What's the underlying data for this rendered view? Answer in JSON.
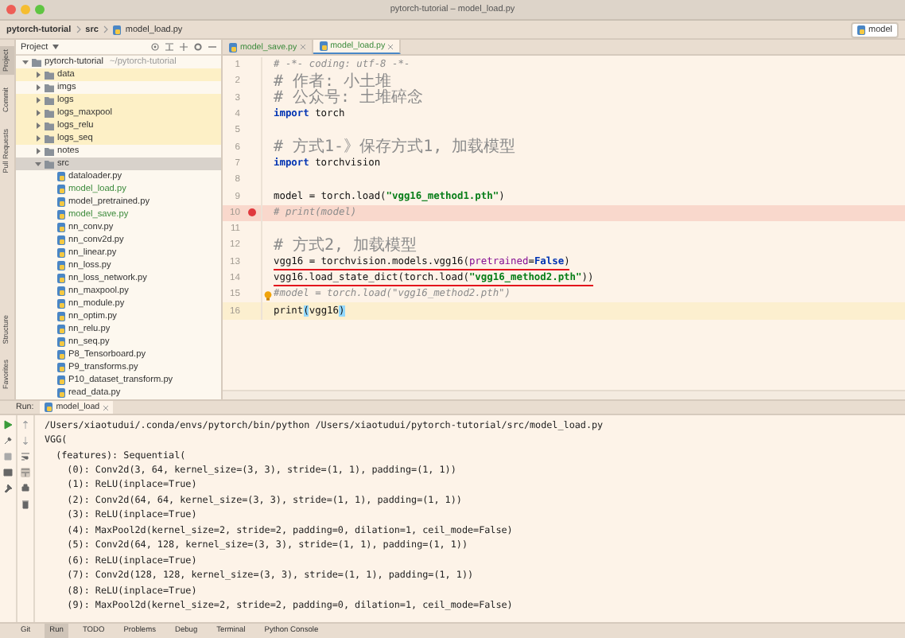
{
  "window": {
    "title": "pytorch-tutorial – model_load.py"
  },
  "breadcrumb": [
    "pytorch-tutorial",
    "src",
    "model_load.py"
  ],
  "run_config": {
    "label": "model"
  },
  "left_strip": {
    "top": [
      {
        "label": "Project",
        "selected": true
      },
      {
        "label": "Commit",
        "selected": false
      },
      {
        "label": "Pull Requests",
        "selected": false
      }
    ],
    "bottom": [
      {
        "label": "Structure",
        "selected": false
      },
      {
        "label": "Favorites",
        "selected": false
      }
    ]
  },
  "project_panel": {
    "title": "Project",
    "tree": [
      {
        "label": "pytorch-tutorial",
        "path": "~/pytorch-tutorial",
        "kind": "folder",
        "expanded": true,
        "selected": false,
        "excluded": false,
        "added": false,
        "children": [
          {
            "label": "data",
            "kind": "folder",
            "expanded": false,
            "selected": false,
            "excluded": true,
            "added": false
          },
          {
            "label": "imgs",
            "kind": "folder",
            "expanded": false,
            "selected": false,
            "excluded": false,
            "added": false
          },
          {
            "label": "logs",
            "kind": "folder",
            "expanded": false,
            "selected": false,
            "excluded": true,
            "added": false
          },
          {
            "label": "logs_maxpool",
            "kind": "folder",
            "expanded": false,
            "selected": false,
            "excluded": true,
            "added": false
          },
          {
            "label": "logs_relu",
            "kind": "folder",
            "expanded": false,
            "selected": false,
            "excluded": true,
            "added": false
          },
          {
            "label": "logs_seq",
            "kind": "folder",
            "expanded": false,
            "selected": false,
            "excluded": true,
            "added": false
          },
          {
            "label": "notes",
            "kind": "folder",
            "expanded": false,
            "selected": false,
            "excluded": false,
            "added": false
          },
          {
            "label": "src",
            "kind": "folder",
            "expanded": true,
            "selected": true,
            "excluded": false,
            "added": false,
            "children": [
              {
                "label": "dataloader.py",
                "kind": "file",
                "selected": false,
                "excluded": false,
                "added": false
              },
              {
                "label": "model_load.py",
                "kind": "file",
                "selected": false,
                "excluded": false,
                "added": true
              },
              {
                "label": "model_pretrained.py",
                "kind": "file",
                "selected": false,
                "excluded": false,
                "added": false
              },
              {
                "label": "model_save.py",
                "kind": "file",
                "selected": false,
                "excluded": false,
                "added": true
              },
              {
                "label": "nn_conv.py",
                "kind": "file",
                "selected": false,
                "excluded": false,
                "added": false
              },
              {
                "label": "nn_conv2d.py",
                "kind": "file",
                "selected": false,
                "excluded": false,
                "added": false
              },
              {
                "label": "nn_linear.py",
                "kind": "file",
                "selected": false,
                "excluded": false,
                "added": false
              },
              {
                "label": "nn_loss.py",
                "kind": "file",
                "selected": false,
                "excluded": false,
                "added": false
              },
              {
                "label": "nn_loss_network.py",
                "kind": "file",
                "selected": false,
                "excluded": false,
                "added": false
              },
              {
                "label": "nn_maxpool.py",
                "kind": "file",
                "selected": false,
                "excluded": false,
                "added": false
              },
              {
                "label": "nn_module.py",
                "kind": "file",
                "selected": false,
                "excluded": false,
                "added": false
              },
              {
                "label": "nn_optim.py",
                "kind": "file",
                "selected": false,
                "excluded": false,
                "added": false
              },
              {
                "label": "nn_relu.py",
                "kind": "file",
                "selected": false,
                "excluded": false,
                "added": false
              },
              {
                "label": "nn_seq.py",
                "kind": "file",
                "selected": false,
                "excluded": false,
                "added": false
              },
              {
                "label": "P8_Tensorboard.py",
                "kind": "file",
                "selected": false,
                "excluded": false,
                "added": false
              },
              {
                "label": "P9_transforms.py",
                "kind": "file",
                "selected": false,
                "excluded": false,
                "added": false
              },
              {
                "label": "P10_dataset_transform.py",
                "kind": "file",
                "selected": false,
                "excluded": false,
                "added": false
              },
              {
                "label": "read_data.py",
                "kind": "file",
                "selected": false,
                "excluded": false,
                "added": false
              }
            ]
          }
        ]
      }
    ]
  },
  "editor": {
    "tabs": [
      {
        "label": "model_save.py",
        "selected": false
      },
      {
        "label": "model_load.py",
        "selected": true
      }
    ],
    "lines": [
      {
        "number": "1",
        "breakpoint": false,
        "current": false,
        "underlined": false,
        "intention": false,
        "segments": [
          {
            "text": "# -*- coding: utf-8 -*-",
            "kind": "comment"
          }
        ]
      },
      {
        "number": "2",
        "breakpoint": false,
        "current": false,
        "underlined": false,
        "intention": false,
        "segments": [
          {
            "text": "# 作者: 小土堆",
            "kind": "comment"
          }
        ]
      },
      {
        "number": "3",
        "breakpoint": false,
        "current": false,
        "underlined": false,
        "intention": false,
        "segments": [
          {
            "text": "# 公众号: 土堆碎念",
            "kind": "comment"
          }
        ]
      },
      {
        "number": "4",
        "breakpoint": false,
        "current": false,
        "underlined": false,
        "intention": false,
        "segments": [
          {
            "text": "import",
            "kind": "keyword"
          },
          {
            "text": " torch",
            "kind": "plain"
          }
        ]
      },
      {
        "number": "5",
        "breakpoint": false,
        "current": false,
        "intention": false
      },
      {
        "number": "6",
        "breakpoint": false,
        "current": false,
        "underlined": false,
        "intention": false,
        "segments": [
          {
            "text": "# 方式1-》保存方式1, 加载模型",
            "kind": "comment"
          }
        ]
      },
      {
        "number": "7",
        "breakpoint": false,
        "current": false,
        "underlined": false,
        "intention": false,
        "segments": [
          {
            "text": "import",
            "kind": "keyword"
          },
          {
            "text": " torchvision",
            "kind": "plain"
          }
        ]
      },
      {
        "number": "8",
        "breakpoint": false,
        "current": false,
        "intention": false
      },
      {
        "number": "9",
        "breakpoint": false,
        "current": false,
        "underlined": false,
        "intention": false,
        "segments": [
          {
            "text": "model = torch.load(",
            "kind": "plain"
          },
          {
            "text": "\"vgg16_method1.pth\"",
            "kind": "string"
          },
          {
            "text": ")",
            "kind": "plain"
          }
        ]
      },
      {
        "number": "10",
        "breakpoint": true,
        "current": false,
        "underlined": false,
        "intention": false,
        "segments": [
          {
            "text": "# print(model)",
            "kind": "comment"
          }
        ]
      },
      {
        "number": "11",
        "breakpoint": false,
        "current": false,
        "intention": false
      },
      {
        "number": "12",
        "breakpoint": false,
        "current": false,
        "underlined": false,
        "intention": false,
        "segments": [
          {
            "text": "# 方式2, 加载模型",
            "kind": "comment"
          }
        ]
      },
      {
        "number": "13",
        "breakpoint": false,
        "current": false,
        "underlined": true,
        "intention": false,
        "segments": [
          {
            "text": "vgg16 = torchvision.models.vgg16(",
            "kind": "plain"
          },
          {
            "text": "pretrained",
            "kind": "param"
          },
          {
            "text": "=",
            "kind": "plain"
          },
          {
            "text": "False",
            "kind": "keyword"
          },
          {
            "text": ")",
            "kind": "plain"
          }
        ]
      },
      {
        "number": "14",
        "breakpoint": false,
        "current": false,
        "underlined": true,
        "intention": false,
        "segments": [
          {
            "text": "vgg16.load_state_dict(torch.load(",
            "kind": "plain"
          },
          {
            "text": "\"vgg16_method2.pth\"",
            "kind": "string"
          },
          {
            "text": "))",
            "kind": "plain"
          }
        ]
      },
      {
        "number": "15",
        "breakpoint": false,
        "current": false,
        "underlined": false,
        "intention": true,
        "segments": [
          {
            "text": "#model = torch.load(\"vgg16_method2.pth\")",
            "kind": "comment"
          }
        ]
      },
      {
        "number": "16",
        "breakpoint": false,
        "current": true,
        "underlined": false,
        "intention": false,
        "segments": [
          {
            "text": "print",
            "kind": "plain"
          },
          {
            "text": "(",
            "kind": "brace"
          },
          {
            "text": "vgg16",
            "kind": "plain"
          },
          {
            "text": ")",
            "kind": "brace"
          }
        ]
      }
    ]
  },
  "run_panel": {
    "label": "Run:",
    "tab": "model_load",
    "output": [
      "/Users/xiaotudui/.conda/envs/pytorch/bin/python /Users/xiaotudui/pytorch-tutorial/src/model_load.py",
      "VGG(",
      "  (features): Sequential(",
      "    (0): Conv2d(3, 64, kernel_size=(3, 3), stride=(1, 1), padding=(1, 1))",
      "    (1): ReLU(inplace=True)",
      "    (2): Conv2d(64, 64, kernel_size=(3, 3), stride=(1, 1), padding=(1, 1))",
      "    (3): ReLU(inplace=True)",
      "    (4): MaxPool2d(kernel_size=2, stride=2, padding=0, dilation=1, ceil_mode=False)",
      "    (5): Conv2d(64, 128, kernel_size=(3, 3), stride=(1, 1), padding=(1, 1))",
      "    (6): ReLU(inplace=True)",
      "    (7): Conv2d(128, 128, kernel_size=(3, 3), stride=(1, 1), padding=(1, 1))",
      "    (8): ReLU(inplace=True)",
      "    (9): MaxPool2d(kernel_size=2, stride=2, padding=0, dilation=1, ceil_mode=False)"
    ]
  },
  "status_tabs": [
    {
      "label": "Git",
      "selected": false
    },
    {
      "label": "Run",
      "selected": true
    },
    {
      "label": "TODO",
      "selected": false
    },
    {
      "label": "Problems",
      "selected": false
    },
    {
      "label": "Debug",
      "selected": false
    },
    {
      "label": "Terminal",
      "selected": false
    },
    {
      "label": "Python Console",
      "selected": false
    }
  ]
}
